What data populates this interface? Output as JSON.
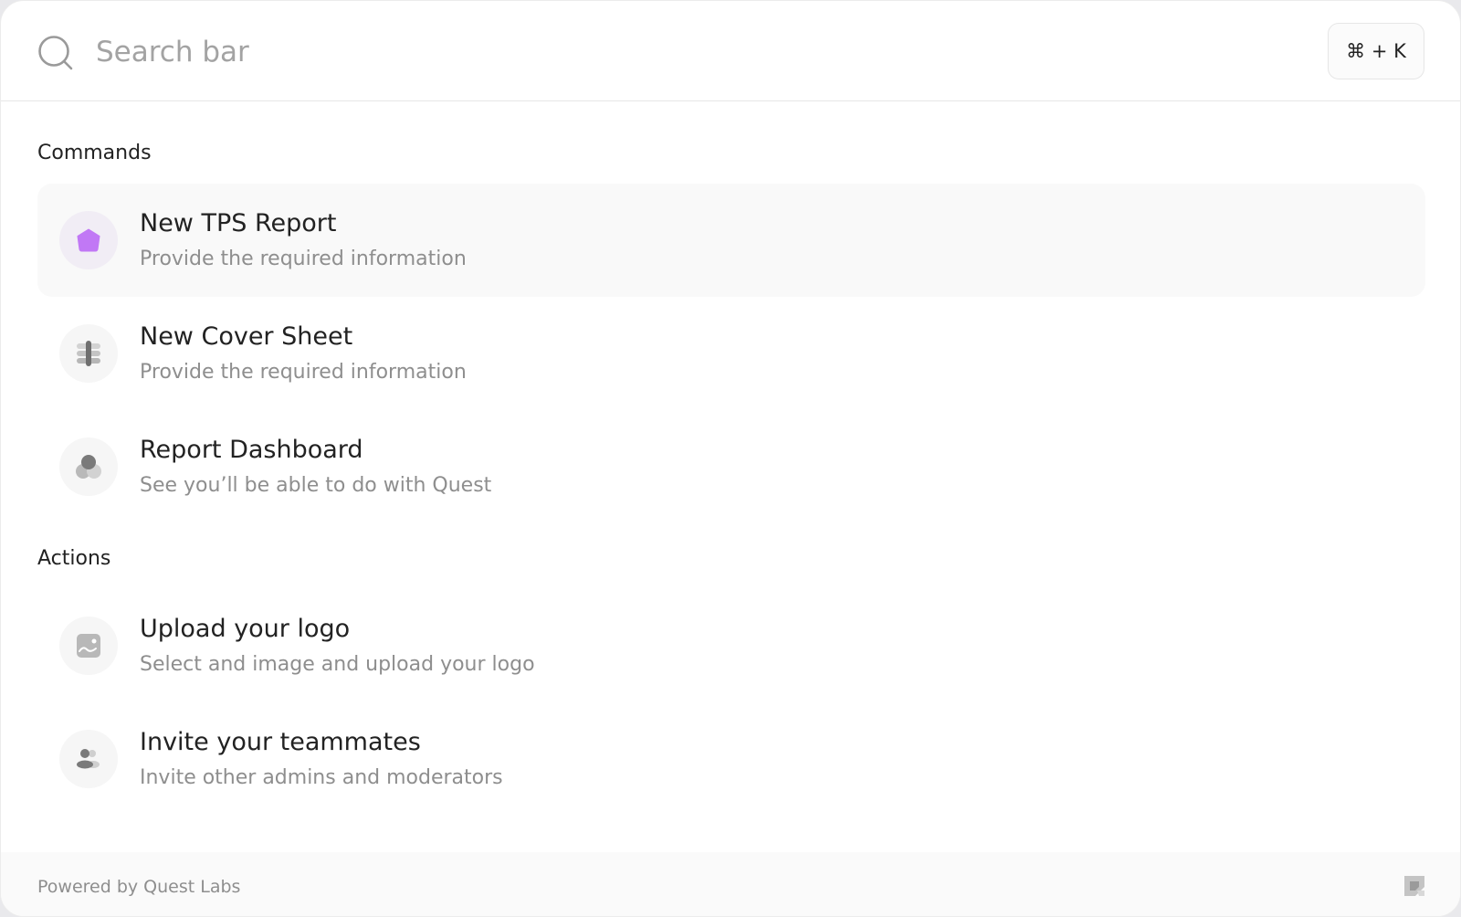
{
  "search": {
    "placeholder": "Search bar",
    "shortcut": "⌘ + K"
  },
  "sections": {
    "commands": {
      "title": "Commands",
      "items": [
        {
          "title": "New TPS Report",
          "description": "Provide the required information",
          "icon": "pentagon-icon",
          "icon_color": "#c178f5",
          "active": true
        },
        {
          "title": "New Cover Sheet",
          "description": "Provide the required information",
          "icon": "layers-icon",
          "icon_color": "#9a9a9a",
          "active": false
        },
        {
          "title": "Report Dashboard",
          "description": "See you’ll be able to do with Quest",
          "icon": "circles-icon",
          "icon_color": "#8a8a8a",
          "active": false
        }
      ]
    },
    "actions": {
      "title": "Actions",
      "items": [
        {
          "title": "Upload your logo",
          "description": "Select and image and upload your logo",
          "icon": "image-icon",
          "icon_color": "#a0a0a0"
        },
        {
          "title": "Invite your teammates",
          "description": "Invite other admins and moderators",
          "icon": "users-icon",
          "icon_color": "#8a8a8a"
        }
      ]
    }
  },
  "footer": {
    "text": "Powered by Quest Labs",
    "logo_icon": "quest-logo-icon"
  },
  "colors": {
    "accent": "#c178f5",
    "text_primary": "#222222",
    "text_secondary": "#8e8e8e",
    "active_row_bg": "#f9f9f9"
  }
}
